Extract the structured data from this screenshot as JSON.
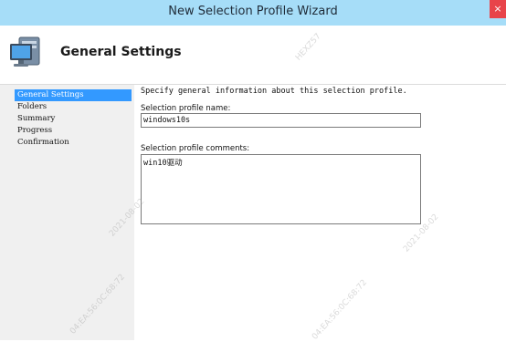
{
  "window": {
    "title": "New Selection Profile Wizard",
    "close_glyph": "×"
  },
  "header": {
    "heading": "General Settings",
    "icon": "computer-icon"
  },
  "nav": {
    "items": [
      {
        "label": "General Settings",
        "selected": true
      },
      {
        "label": "Folders",
        "selected": false
      },
      {
        "label": "Summary",
        "selected": false
      },
      {
        "label": "Progress",
        "selected": false
      },
      {
        "label": "Confirmation",
        "selected": false
      }
    ]
  },
  "form": {
    "intro": "Specify general information about this selection profile.",
    "name_label": "Selection profile name:",
    "name_value": "windows10s",
    "comments_label": "Selection profile comments:",
    "comments_value": "win10驱动"
  },
  "watermark": {
    "text_a": "HEXZ57",
    "text_b": "04:EA:56:0C:68:72",
    "text_c": "2021-08-02"
  },
  "colors": {
    "titlebar": "#a6ddf8",
    "selected": "#3399ff",
    "close": "#e8444a"
  }
}
